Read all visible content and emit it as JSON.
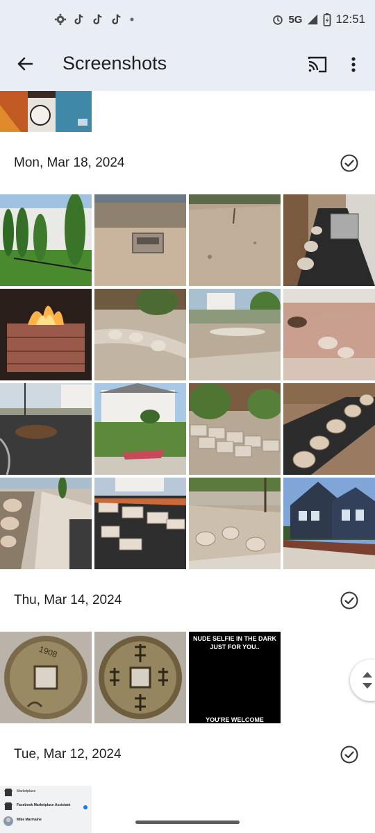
{
  "status_bar": {
    "left_icons": [
      "gear-icon",
      "tiktok-icon",
      "tiktok-icon",
      "tiktok-icon",
      "dot-icon"
    ],
    "network": "5G",
    "time": "12:51"
  },
  "app_bar": {
    "title": "Screenshots"
  },
  "sections": [
    {
      "date": "Mon, Mar 18, 2024"
    },
    {
      "date": "Thu, Mar 14, 2024"
    },
    {
      "date": "Tue, Mar 12, 2024"
    }
  ],
  "thumbnails": {
    "meme_top_text": "NUDE SELFIE IN THE DARK JUST FOR YOU..",
    "meme_bottom_text": "YOU'RE WELCOME",
    "coin_text": "1908",
    "fb_rows": [
      "Marketplace",
      "Facebook Marketplace Assistant",
      "Mike Marmaine"
    ]
  },
  "colors": {
    "bar_bg": "#e8eef3",
    "text": "#1f1f1f"
  }
}
